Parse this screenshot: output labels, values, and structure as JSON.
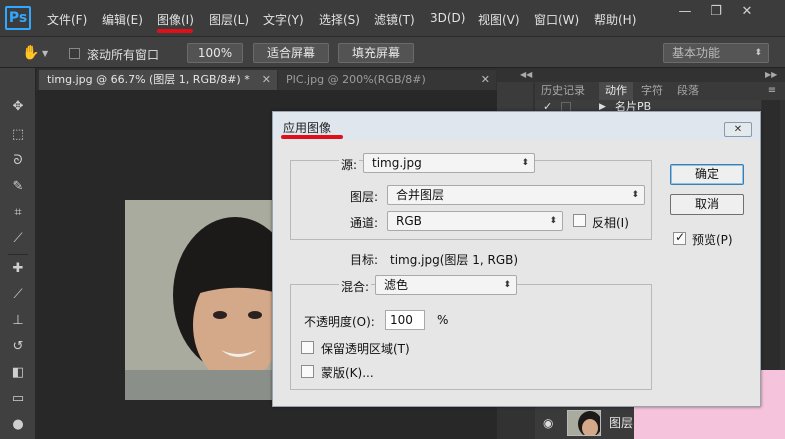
{
  "app": {
    "logo_text": "Ps",
    "accent_color": "#31a8ff",
    "annotation_color": "#e0101a"
  },
  "menubar": {
    "items": [
      {
        "label": "文件(F)"
      },
      {
        "label": "编辑(E)"
      },
      {
        "label": "图像(I)"
      },
      {
        "label": "图层(L)"
      },
      {
        "label": "文字(Y)"
      },
      {
        "label": "选择(S)"
      },
      {
        "label": "滤镜(T)"
      },
      {
        "label": "3D(D)"
      },
      {
        "label": "视图(V)"
      },
      {
        "label": "窗口(W)"
      },
      {
        "label": "帮助(H)"
      }
    ],
    "window_controls": {
      "minimize": "—",
      "restore": "❐",
      "close": "✕"
    }
  },
  "options_bar": {
    "tool_icon": "hand-icon",
    "scroll_all_windows_label": "滚动所有窗口",
    "scroll_all_windows_checked": false,
    "zoom_100_label": "100%",
    "fit_screen_label": "适合屏幕",
    "fill_screen_label": "填充屏幕",
    "workspace_label": "基本功能"
  },
  "tools": [
    "move-icon",
    "marquee-icon",
    "lasso-icon",
    "quick-select-icon",
    "crop-icon",
    "eyedropper-icon",
    "healing-brush-icon",
    "brush-icon",
    "clone-stamp-icon",
    "history-brush-icon",
    "eraser-icon",
    "gradient-icon",
    "blur-icon"
  ],
  "document_tabs": [
    {
      "label": "timg.jpg @ 66.7% (图层 1, RGB/8#) *",
      "active": true
    },
    {
      "label": "PIC.jpg @ 200%(RGB/8#) ",
      "active": false
    }
  ],
  "right_panel": {
    "tabs": [
      {
        "label": "历史记录",
        "active": false
      },
      {
        "label": "动作",
        "active": true
      },
      {
        "label": "字符",
        "active": false
      },
      {
        "label": "段落",
        "active": false
      }
    ],
    "action_row": {
      "check": "✓",
      "label": "名片PB"
    },
    "layer_row": {
      "label": "图层"
    }
  },
  "dialog": {
    "title": "应用图像",
    "close_label": "✕",
    "source_label": "源:",
    "source_value": "timg.jpg",
    "layer_label": "图层:",
    "layer_value": "合并图层",
    "channel_label": "通道:",
    "channel_value": "RGB",
    "invert_label": "反相(I)",
    "invert_checked": false,
    "target_label": "目标:",
    "target_value": "timg.jpg(图层 1, RGB)",
    "blending_label": "混合:",
    "blending_value": "滤色",
    "opacity_label": "不透明度(O):",
    "opacity_value": "100",
    "opacity_unit": "%",
    "preserve_transparency_label": "保留透明区域(T)",
    "preserve_transparency_checked": false,
    "mask_label": "蒙版(K)...",
    "mask_checked": false,
    "ok_label": "确定",
    "cancel_label": "取消",
    "preview_label": "预览(P)",
    "preview_checked": true
  }
}
